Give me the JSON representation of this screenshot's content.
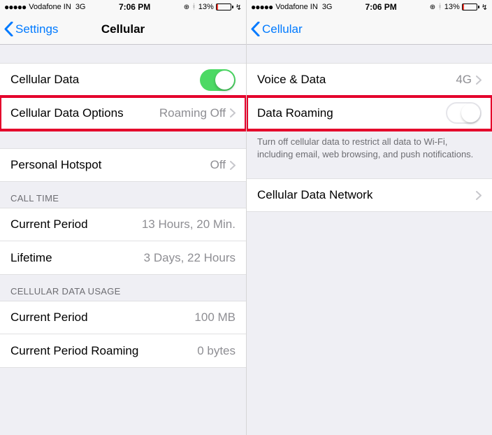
{
  "status_bar": {
    "carrier": "Vodafone IN",
    "network": "3G",
    "time": "7:06 PM",
    "battery_pct": "13%"
  },
  "left": {
    "nav_back": "Settings",
    "nav_title": "Cellular",
    "rows": {
      "cellular_data": "Cellular Data",
      "options": "Cellular Data Options",
      "options_value": "Roaming Off",
      "hotspot": "Personal Hotspot",
      "hotspot_value": "Off"
    },
    "call_time": {
      "header": "CALL TIME",
      "current": "Current Period",
      "current_value": "13 Hours, 20 Min.",
      "lifetime": "Lifetime",
      "lifetime_value": "3 Days, 22 Hours"
    },
    "usage": {
      "header": "CELLULAR DATA USAGE",
      "current": "Current Period",
      "current_value": "100 MB",
      "roaming": "Current Period Roaming",
      "roaming_value": "0 bytes"
    }
  },
  "right": {
    "nav_back": "Cellular",
    "rows": {
      "voice_data": "Voice & Data",
      "voice_data_value": "4G",
      "data_roaming": "Data Roaming"
    },
    "footer": "Turn off cellular data to restrict all data to Wi-Fi, including email, web browsing, and push notifications.",
    "network": "Cellular Data Network"
  }
}
